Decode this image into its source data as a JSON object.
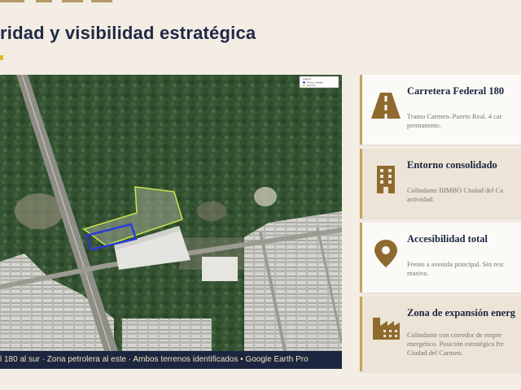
{
  "page": {
    "title": "ridad y visibilidad estratégica"
  },
  "map": {
    "legend_title": "Legend",
    "legend_items": [
      "Terreno 1 (Bimbo)",
      "Terreno 2"
    ],
    "caption": "l 180 al sur  ·  Zona petrolera al este  ·  Ambos terrenos identificados   •   Google Earth Pro"
  },
  "cards": [
    {
      "icon": "road-icon",
      "title": "Carretera Federal 180",
      "text_lines": [
        "Tramo Carmen–Puerto Real. 4 car",
        "permanente."
      ]
    },
    {
      "icon": "building-icon",
      "title": "Entorno consolidado",
      "text_lines": [
        "Colindante BIMBO Ciudad del Ca",
        "actividad."
      ]
    },
    {
      "icon": "location-pin-icon",
      "title": "Accesibilidad total",
      "text_lines": [
        "Frente a avenida principal. Sin rest",
        "masiva."
      ]
    },
    {
      "icon": "industry-icon",
      "title": "Zona de expansión energ",
      "text_lines": [
        "Colindante con corredor de empre",
        "energético. Posición estratégica fre",
        "Ciudad del Carmen."
      ]
    }
  ],
  "colors": {
    "background": "#f3ede4",
    "navy": "#1c2641",
    "gold": "#c9a25d",
    "icon_brown": "#8f6a2e",
    "caption_text": "#f1e2bb",
    "plot_outline": "#c6e84a",
    "plot_highlight": "#2b3bd6"
  }
}
